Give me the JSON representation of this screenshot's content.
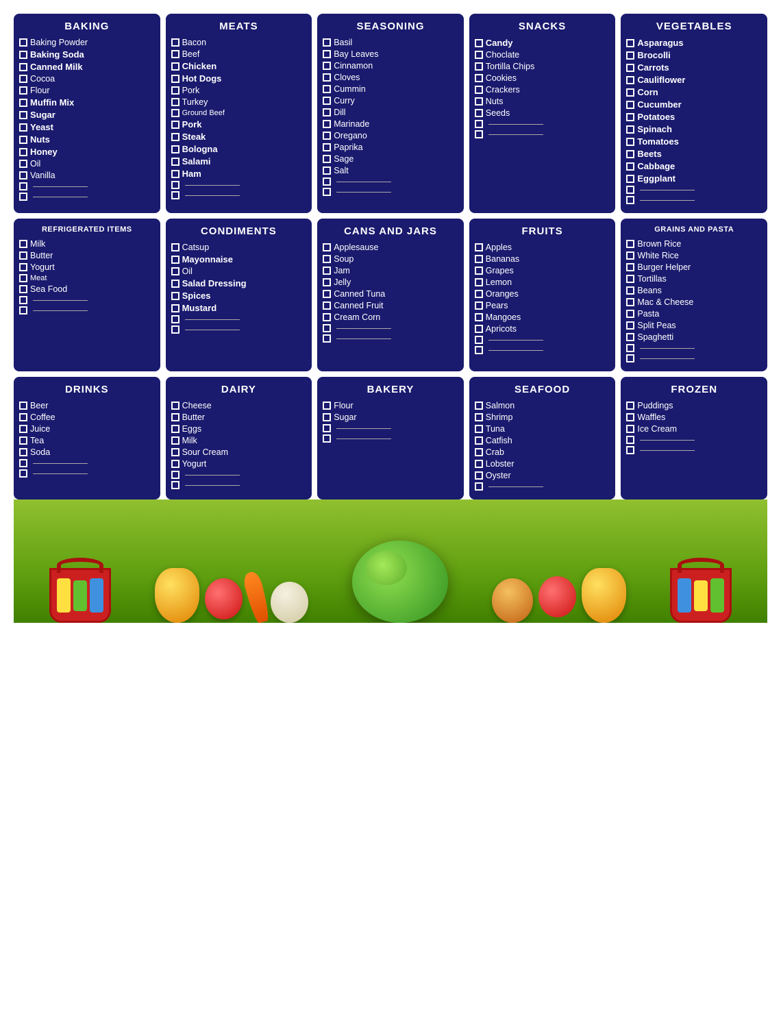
{
  "categories": [
    {
      "id": "baking",
      "title": "BAKING",
      "items": [
        {
          "text": "Baking Powder",
          "bold": false
        },
        {
          "text": "Baking Soda",
          "bold": true
        },
        {
          "text": "Canned Milk",
          "bold": true
        },
        {
          "text": "Cocoa",
          "bold": false
        },
        {
          "text": "Flour",
          "bold": false
        },
        {
          "text": "Muffin Mix",
          "bold": true
        },
        {
          "text": "Sugar",
          "bold": true
        },
        {
          "text": "Yeast",
          "bold": true
        },
        {
          "text": "Nuts",
          "bold": true
        },
        {
          "text": "Honey",
          "bold": true
        },
        {
          "text": "Oil",
          "bold": false
        },
        {
          "text": "Vanilla",
          "bold": false
        },
        {
          "text": "",
          "blank": true
        },
        {
          "text": "",
          "blank": true
        }
      ]
    },
    {
      "id": "meats",
      "title": "MEATS",
      "items": [
        {
          "text": "Bacon",
          "bold": false
        },
        {
          "text": "Beef",
          "bold": false
        },
        {
          "text": "Chicken",
          "bold": true
        },
        {
          "text": "Hot Dogs",
          "bold": true
        },
        {
          "text": "Pork",
          "bold": false
        },
        {
          "text": "Turkey",
          "bold": false
        },
        {
          "text": "Ground Beef",
          "bold": false,
          "small": true
        },
        {
          "text": "Pork",
          "bold": true
        },
        {
          "text": "Steak",
          "bold": true
        },
        {
          "text": "Bologna",
          "bold": true
        },
        {
          "text": "Salami",
          "bold": true
        },
        {
          "text": "Ham",
          "bold": true
        },
        {
          "text": "",
          "blank": true
        },
        {
          "text": "",
          "blank": true
        }
      ]
    },
    {
      "id": "seasoning",
      "title": "SEASONING",
      "items": [
        {
          "text": "Basil",
          "bold": false
        },
        {
          "text": "Bay Leaves",
          "bold": false
        },
        {
          "text": "Cinnamon",
          "bold": false
        },
        {
          "text": "Cloves",
          "bold": false
        },
        {
          "text": "Cummin",
          "bold": false
        },
        {
          "text": "Curry",
          "bold": false
        },
        {
          "text": "Dill",
          "bold": false
        },
        {
          "text": "Marinade",
          "bold": false
        },
        {
          "text": "Oregano",
          "bold": false
        },
        {
          "text": "Paprika",
          "bold": false
        },
        {
          "text": "Sage",
          "bold": false
        },
        {
          "text": "Salt",
          "bold": false
        },
        {
          "text": "",
          "blank": true
        },
        {
          "text": "",
          "blank": true
        }
      ]
    },
    {
      "id": "snacks",
      "title": "SNACKS",
      "items": [
        {
          "text": "Candy",
          "bold": true
        },
        {
          "text": "Choclate",
          "bold": false
        },
        {
          "text": "Tortilla Chips",
          "bold": false
        },
        {
          "text": "Cookies",
          "bold": false
        },
        {
          "text": "Crackers",
          "bold": false
        },
        {
          "text": "Nuts",
          "bold": false
        },
        {
          "text": "Seeds",
          "bold": false
        },
        {
          "text": "",
          "blank": true
        },
        {
          "text": "",
          "blank": true
        }
      ]
    },
    {
      "id": "vegetables",
      "title": "VEGETABLES",
      "items": [
        {
          "text": "Asparagus",
          "bold": true
        },
        {
          "text": "Brocolli",
          "bold": true
        },
        {
          "text": "Carrots",
          "bold": true
        },
        {
          "text": "Cauliflower",
          "bold": true
        },
        {
          "text": "Corn",
          "bold": true
        },
        {
          "text": "Cucumber",
          "bold": true
        },
        {
          "text": "Potatoes",
          "bold": true
        },
        {
          "text": "Spinach",
          "bold": true
        },
        {
          "text": "Tomatoes",
          "bold": true
        },
        {
          "text": "Beets",
          "bold": true
        },
        {
          "text": "Cabbage",
          "bold": true
        },
        {
          "text": "Eggplant",
          "bold": true
        },
        {
          "text": "",
          "blank": true
        },
        {
          "text": "",
          "blank": true
        }
      ]
    },
    {
      "id": "refrigerated",
      "title": "REFRIGERATED ITEMS",
      "smallTitle": true,
      "items": [
        {
          "text": "Milk",
          "bold": false
        },
        {
          "text": "Butter",
          "bold": false
        },
        {
          "text": "Yogurt",
          "bold": false
        },
        {
          "text": "Meat",
          "bold": false,
          "small": true
        },
        {
          "text": "Sea Food",
          "bold": false
        },
        {
          "text": "",
          "blank": true
        },
        {
          "text": "",
          "blank": true
        }
      ]
    },
    {
      "id": "condiments",
      "title": "CONDIMENTS",
      "items": [
        {
          "text": "Catsup",
          "bold": false
        },
        {
          "text": "Mayonnaise",
          "bold": true
        },
        {
          "text": "Oil",
          "bold": false
        },
        {
          "text": "Salad Dressing",
          "bold": true
        },
        {
          "text": "Spices",
          "bold": true
        },
        {
          "text": "Mustard",
          "bold": true
        },
        {
          "text": "",
          "blank": true
        },
        {
          "text": "",
          "blank": true
        }
      ]
    },
    {
      "id": "cans-jars",
      "title": "CANS AND JARS",
      "items": [
        {
          "text": "Applesause",
          "bold": false
        },
        {
          "text": "Soup",
          "bold": false
        },
        {
          "text": "Jam",
          "bold": false
        },
        {
          "text": "Jelly",
          "bold": false
        },
        {
          "text": "Canned Tuna",
          "bold": false
        },
        {
          "text": "Canned Fruit",
          "bold": false
        },
        {
          "text": "Cream Corn",
          "bold": false
        },
        {
          "text": "",
          "blank": true
        },
        {
          "text": "",
          "blank": true
        }
      ]
    },
    {
      "id": "fruits",
      "title": "FRUITS",
      "items": [
        {
          "text": "Apples",
          "bold": false
        },
        {
          "text": "Bananas",
          "bold": false
        },
        {
          "text": "Grapes",
          "bold": false
        },
        {
          "text": "Lemon",
          "bold": false
        },
        {
          "text": "Oranges",
          "bold": false
        },
        {
          "text": "Pears",
          "bold": false
        },
        {
          "text": "Mangoes",
          "bold": false
        },
        {
          "text": "Apricots",
          "bold": false
        },
        {
          "text": "",
          "blank": true
        },
        {
          "text": "",
          "blank": true
        }
      ]
    },
    {
      "id": "grains-pasta",
      "title": "GRAINS AND PASTA",
      "smallTitle": true,
      "items": [
        {
          "text": "Brown Rice",
          "bold": false
        },
        {
          "text": "White Rice",
          "bold": false
        },
        {
          "text": "Burger Helper",
          "bold": false
        },
        {
          "text": "Tortillas",
          "bold": false
        },
        {
          "text": "Beans",
          "bold": false
        },
        {
          "text": "Mac & Cheese",
          "bold": false
        },
        {
          "text": "Pasta",
          "bold": false
        },
        {
          "text": "Split Peas",
          "bold": false
        },
        {
          "text": "Spaghetti",
          "bold": false
        },
        {
          "text": "",
          "blank": true
        },
        {
          "text": "",
          "blank": true
        }
      ]
    },
    {
      "id": "drinks",
      "title": "DRINKS",
      "items": [
        {
          "text": "Beer",
          "bold": false
        },
        {
          "text": "Coffee",
          "bold": false
        },
        {
          "text": "Juice",
          "bold": false
        },
        {
          "text": "Tea",
          "bold": false
        },
        {
          "text": "Soda",
          "bold": false
        },
        {
          "text": "",
          "blank": true
        },
        {
          "text": "",
          "blank": true
        }
      ]
    },
    {
      "id": "dairy",
      "title": "DAIRY",
      "items": [
        {
          "text": "Cheese",
          "bold": false
        },
        {
          "text": "Butter",
          "bold": false
        },
        {
          "text": "Eggs",
          "bold": false
        },
        {
          "text": "Milk",
          "bold": false
        },
        {
          "text": "Sour Cream",
          "bold": false
        },
        {
          "text": "Yogurt",
          "bold": false
        },
        {
          "text": "",
          "blank": true
        },
        {
          "text": "",
          "blank": true
        }
      ]
    },
    {
      "id": "bakery",
      "title": "BAKERY",
      "items": [
        {
          "text": "Flour",
          "bold": false
        },
        {
          "text": "Sugar",
          "bold": false
        },
        {
          "text": "",
          "blank": true
        },
        {
          "text": "",
          "blank": true
        }
      ]
    },
    {
      "id": "seafood",
      "title": "SEAFOOD",
      "items": [
        {
          "text": "Salmon",
          "bold": false
        },
        {
          "text": "Shrimp",
          "bold": false
        },
        {
          "text": "Tuna",
          "bold": false
        },
        {
          "text": "Catfish",
          "bold": false
        },
        {
          "text": "Crab",
          "bold": false
        },
        {
          "text": "Lobster",
          "bold": false
        },
        {
          "text": "Oyster",
          "bold": false
        },
        {
          "text": "",
          "blank": true
        }
      ]
    },
    {
      "id": "frozen",
      "title": "FROZEN",
      "items": [
        {
          "text": "Puddings",
          "bold": false
        },
        {
          "text": "Waffles",
          "bold": false
        },
        {
          "text": "Ice Cream",
          "bold": false
        },
        {
          "text": "",
          "blank": true
        },
        {
          "text": "",
          "blank": true
        }
      ]
    }
  ],
  "layout": {
    "bgColor": "#ffffff",
    "cardColor": "#1a1a6e"
  }
}
